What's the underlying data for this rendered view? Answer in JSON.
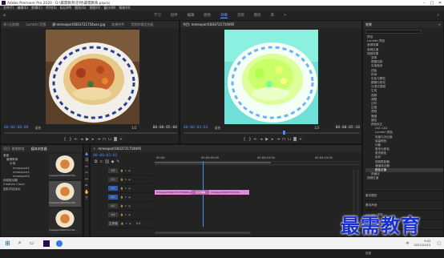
{
  "window": {
    "title": "Adobe Premiere Pro 2020 - D:\\最需教育\\示例\\最需教育.prproj"
  },
  "menu": [
    "文件(F)",
    "编辑(E)",
    "剪辑(C)",
    "序列(S)",
    "标记(M)",
    "图形(G)",
    "视图(V)",
    "窗口(W)",
    "帮助(H)"
  ],
  "workspaces": [
    "学习",
    "组件",
    "编辑",
    "颜色",
    "效果",
    "音频",
    "图形",
    "库"
  ],
  "active_workspace": "效果",
  "source_monitor": {
    "tabs": [
      "源:(无剪辑)",
      "Lumetri 范围",
      "源:mmexport1603721754xxx.jpg",
      "效果控件",
      "音频剪辑混合器"
    ],
    "timecode_left": "00:00:00:00",
    "fit": "适合",
    "page": "1/2",
    "timecode_right": "00:00:05:00"
  },
  "program_monitor": {
    "tabs": [
      "节目: mmexport1603721754695"
    ],
    "timecode_left": "00:00:03:03",
    "fit": "适合",
    "page": "1/2",
    "timecode_right": "00:00:05:10"
  },
  "effects_panel": {
    "title": "效果",
    "items": [
      "预设",
      "Lumetri 预设",
      "音频效果",
      "音频过渡",
      "视频效果",
      "变换",
      "图像控制",
      "实用程序",
      "扭曲",
      "时间",
      "杂色与颗粒",
      "模糊与锐化",
      "沉浸式视频",
      "生成",
      "视频",
      "调整",
      "过时",
      "过渡",
      "透视",
      "通道",
      "键控",
      "颜色校正",
      "ASC CDL",
      "Lumetri 颜色",
      "亮度与对比度",
      "保留颜色",
      "均衡",
      "更改为颜色",
      "更改颜色",
      "色彩",
      "视频限制器",
      "通道混合器",
      "颜色平衡",
      "风格化",
      "视频过渡",
      "浸入视频",
      "溶解",
      "滑动",
      "缩放"
    ],
    "selected": "颜色平衡",
    "lower_panels": [
      "基本图形",
      "基本声音",
      "Lumetri 颜色",
      "库",
      "标记",
      "历史记录",
      "信息"
    ]
  },
  "project_panel": {
    "tabs": [
      "项目: 最需教育",
      "媒体浏览器"
    ],
    "tree": [
      "桌面",
      "最需教育",
      "示例",
      "mmexport1",
      "mmexport2",
      "mmexport3",
      "网络驱动器",
      "Creative Cloud",
      "团队项目版本"
    ],
    "thumbs": [
      "mmexport1603721754...",
      "mmexport1603721749...",
      "mmexport1603721745..."
    ]
  },
  "timeline": {
    "tab": "mmexport1603721754695",
    "timecode": "00:00:03:03",
    "ruler": [
      "00:00",
      "00:00:05:00",
      "00:00:10:00",
      "00:00:15:00"
    ],
    "tracks": [
      "V3",
      "V2",
      "V1",
      "A1",
      "A2",
      "A3",
      "主声道"
    ],
    "clips": [
      "mmexport1603721754695.jpg",
      "交叉溶解",
      "mmexport1603721749..."
    ],
    "master_value": "0.0"
  },
  "watermark": "最需教育",
  "taskbar": {
    "time": "9:42",
    "date": "2021/10/15",
    "lang": "中"
  },
  "colors": {
    "accent": "#4b8df2",
    "clip": "#e28ad8",
    "transition": "#b763b0"
  }
}
